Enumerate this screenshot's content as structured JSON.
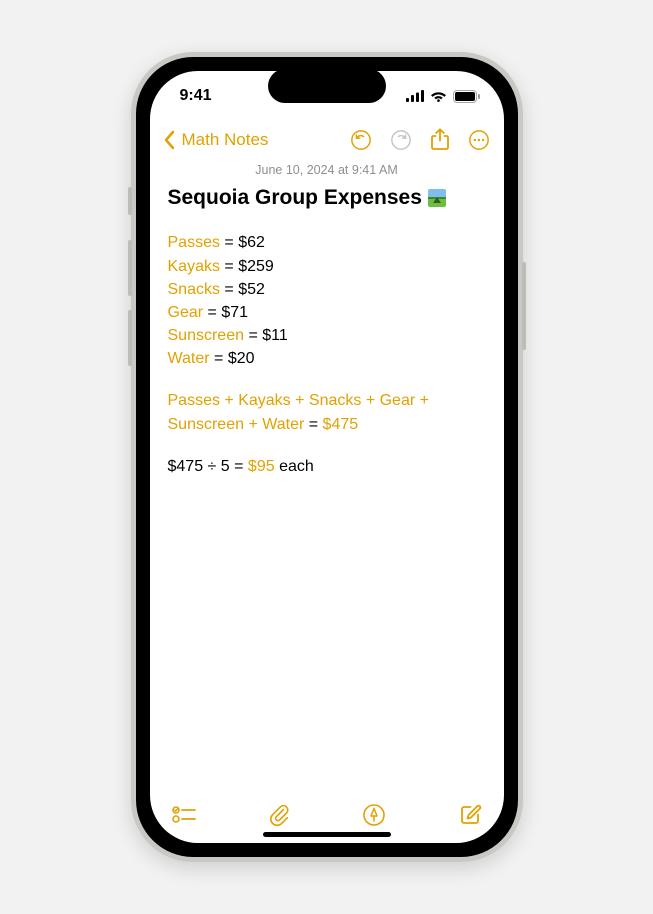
{
  "accent_color": "#e2a100",
  "status": {
    "time": "9:41"
  },
  "nav": {
    "back_label": "Math Notes"
  },
  "note": {
    "date": "June 10, 2024 at 9:41 AM",
    "title": "Sequoia Group Expenses",
    "expenses": [
      {
        "label": "Passes",
        "value": "$62"
      },
      {
        "label": "Kayaks",
        "value": "$259"
      },
      {
        "label": "Snacks",
        "value": "$52"
      },
      {
        "label": "Gear",
        "value": "$71"
      },
      {
        "label": "Sunscreen",
        "value": "$11"
      },
      {
        "label": "Water",
        "value": "$20"
      }
    ],
    "sum_terms": [
      "Passes",
      "Kayaks",
      "Snacks",
      "Gear",
      "Sunscreen",
      "Water"
    ],
    "sum_result": "$475",
    "division": {
      "lhs": "$475 ÷ 5",
      "rhs": "$95",
      "suffix": "each"
    }
  }
}
